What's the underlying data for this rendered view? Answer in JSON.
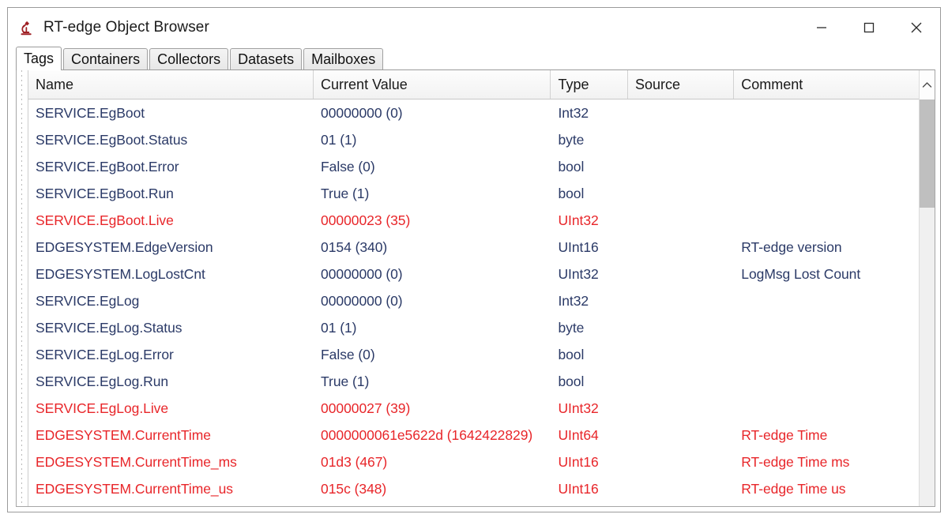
{
  "window": {
    "title": "RT-edge Object Browser",
    "icon": "microscope-icon",
    "icon_color": "#9e1f23",
    "controls": {
      "minimize": "minimize-icon",
      "maximize": "maximize-icon",
      "close": "close-icon"
    }
  },
  "tabs": [
    {
      "label": "Tags",
      "active": true
    },
    {
      "label": "Containers",
      "active": false
    },
    {
      "label": "Collectors",
      "active": false
    },
    {
      "label": "Datasets",
      "active": false
    },
    {
      "label": "Mailboxes",
      "active": false
    }
  ],
  "table": {
    "columns": [
      "Name",
      "Current Value",
      "Type",
      "Source",
      "Comment"
    ],
    "colors": {
      "normal_text": "#2b3a67",
      "alert_text": "#e8262a"
    },
    "rows": [
      {
        "name": "SERVICE.EgBoot",
        "value": "00000000 (0)",
        "type": "Int32",
        "source": "",
        "comment": "",
        "state": "normal"
      },
      {
        "name": "SERVICE.EgBoot.Status",
        "value": "01 (1)",
        "type": "byte",
        "source": "",
        "comment": "",
        "state": "normal"
      },
      {
        "name": "SERVICE.EgBoot.Error",
        "value": "False (0)",
        "type": "bool",
        "source": "",
        "comment": "",
        "state": "normal"
      },
      {
        "name": "SERVICE.EgBoot.Run",
        "value": "True (1)",
        "type": "bool",
        "source": "",
        "comment": "",
        "state": "normal"
      },
      {
        "name": "SERVICE.EgBoot.Live",
        "value": "00000023 (35)",
        "type": "UInt32",
        "source": "",
        "comment": "",
        "state": "alert"
      },
      {
        "name": "EDGESYSTEM.EdgeVersion",
        "value": "0154 (340)",
        "type": "UInt16",
        "source": "",
        "comment": "RT-edge version",
        "state": "normal"
      },
      {
        "name": "EDGESYSTEM.LogLostCnt",
        "value": "00000000 (0)",
        "type": "UInt32",
        "source": "",
        "comment": "LogMsg Lost Count",
        "state": "normal"
      },
      {
        "name": "SERVICE.EgLog",
        "value": "00000000 (0)",
        "type": "Int32",
        "source": "",
        "comment": "",
        "state": "normal"
      },
      {
        "name": "SERVICE.EgLog.Status",
        "value": "01 (1)",
        "type": "byte",
        "source": "",
        "comment": "",
        "state": "normal"
      },
      {
        "name": "SERVICE.EgLog.Error",
        "value": "False (0)",
        "type": "bool",
        "source": "",
        "comment": "",
        "state": "normal"
      },
      {
        "name": "SERVICE.EgLog.Run",
        "value": "True (1)",
        "type": "bool",
        "source": "",
        "comment": "",
        "state": "normal"
      },
      {
        "name": "SERVICE.EgLog.Live",
        "value": "00000027 (39)",
        "type": "UInt32",
        "source": "",
        "comment": "",
        "state": "alert"
      },
      {
        "name": "EDGESYSTEM.CurrentTime",
        "value": "0000000061e5622d (1642422829)",
        "type": "UInt64",
        "source": "",
        "comment": "RT-edge Time",
        "state": "alert"
      },
      {
        "name": "EDGESYSTEM.CurrentTime_ms",
        "value": "01d3 (467)",
        "type": "UInt16",
        "source": "",
        "comment": "RT-edge Time ms",
        "state": "alert"
      },
      {
        "name": "EDGESYSTEM.CurrentTime_us",
        "value": "015c (348)",
        "type": "UInt16",
        "source": "",
        "comment": "RT-edge Time us",
        "state": "alert"
      }
    ]
  },
  "scrollbar": {
    "up_arrow": "chevron-up-icon"
  }
}
